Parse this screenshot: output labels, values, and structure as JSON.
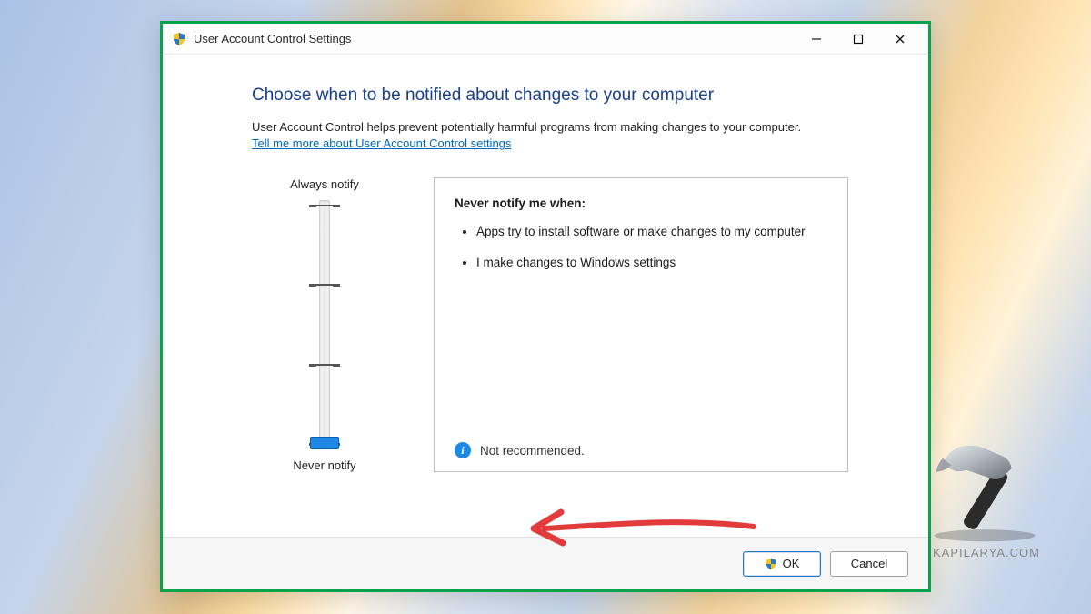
{
  "window": {
    "title": "User Account Control Settings"
  },
  "heading": "Choose when to be notified about changes to your computer",
  "description": "User Account Control helps prevent potentially harmful programs from making changes to your computer.",
  "link_text": "Tell me more about User Account Control settings",
  "slider": {
    "top_label": "Always notify",
    "bottom_label": "Never notify",
    "levels": 4,
    "current_level_index": 3
  },
  "info": {
    "title": "Never notify me when:",
    "bullets": [
      "Apps try to install software or make changes to my computer",
      "I make changes to Windows settings"
    ],
    "footer_text": "Not recommended."
  },
  "buttons": {
    "ok": "OK",
    "cancel": "Cancel"
  },
  "watermark": "KAPILARYA.COM"
}
